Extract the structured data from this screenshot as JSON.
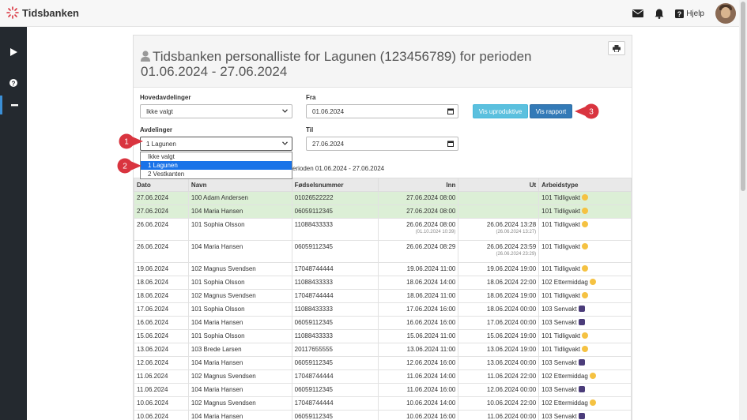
{
  "app": {
    "brand": "Tidsbanken",
    "help_label": "Hjelp"
  },
  "page": {
    "title": "Tidsbanken personalliste for Lagunen (123456789) for perioden 01.06.2024 - 27.06.2024"
  },
  "form": {
    "hovedavdelinger_label": "Hovedavdelinger",
    "hovedavdelinger_value": "Ikke valgt",
    "avdelinger_label": "Avdelinger",
    "avdelinger_value": "1 Lagunen",
    "avdelinger_options": [
      "Ikke valgt",
      "1 Lagunen",
      "2 Vestkanten"
    ],
    "fra_label": "Fra",
    "fra_value": "01.06.2024",
    "til_label": "Til",
    "til_value": "27.06.2024",
    "vis_uproduktive": "Vis uproduktive",
    "vis_rapport": "Vis rapport",
    "period_text": "erioden 01.06.2024 - 27.06.2024"
  },
  "callouts": [
    "1",
    "2",
    "3"
  ],
  "table": {
    "headers": [
      "Dato",
      "Navn",
      "Fødselsnummer",
      "Inn",
      "Ut",
      "Arbeidstype"
    ],
    "rows": [
      {
        "dato": "27.06.2024",
        "navn": "100 Adam Andersen",
        "fnr": "01026522222",
        "inn": "27.06.2024 08:00",
        "inn_sub": "",
        "ut": "",
        "ut_sub": "",
        "type": "101 Tidligvakt",
        "icon": "sun",
        "green": true
      },
      {
        "dato": "27.06.2024",
        "navn": "104 Maria Hansen",
        "fnr": "06059112345",
        "inn": "27.06.2024 08:00",
        "inn_sub": "",
        "ut": "",
        "ut_sub": "",
        "type": "101 Tidligvakt",
        "icon": "sun",
        "green": true
      },
      {
        "dato": "26.06.2024",
        "navn": "101 Sophia Olsson",
        "fnr": "11088433333",
        "inn": "26.06.2024 08:00",
        "inn_sub": "(01.10.2024 10:39)",
        "ut": "26.06.2024 13:28",
        "ut_sub": "(26.06.2024 13:27)",
        "type": "101 Tidligvakt",
        "icon": "sun",
        "green": false
      },
      {
        "dato": "26.06.2024",
        "navn": "104 Maria Hansen",
        "fnr": "06059112345",
        "inn": "26.06.2024 08:29",
        "inn_sub": "",
        "ut": "26.06.2024 23:59",
        "ut_sub": "(26.06.2024 23:29)",
        "type": "101 Tidligvakt",
        "icon": "sun",
        "green": false
      },
      {
        "dato": "19.06.2024",
        "navn": "102 Magnus Svendsen",
        "fnr": "17048744444",
        "inn": "19.06.2024 11:00",
        "inn_sub": "",
        "ut": "19.06.2024 19:00",
        "ut_sub": "",
        "type": "101 Tidligvakt",
        "icon": "sun",
        "green": false
      },
      {
        "dato": "18.06.2024",
        "navn": "101 Sophia Olsson",
        "fnr": "11088433333",
        "inn": "18.06.2024 14:00",
        "inn_sub": "",
        "ut": "18.06.2024 22:00",
        "ut_sub": "",
        "type": "102 Ettermiddag",
        "icon": "sun",
        "green": false
      },
      {
        "dato": "18.06.2024",
        "navn": "102 Magnus Svendsen",
        "fnr": "17048744444",
        "inn": "18.06.2024 11:00",
        "inn_sub": "",
        "ut": "18.06.2024 19:00",
        "ut_sub": "",
        "type": "101 Tidligvakt",
        "icon": "sun",
        "green": false
      },
      {
        "dato": "17.06.2024",
        "navn": "101 Sophia Olsson",
        "fnr": "11088433333",
        "inn": "17.06.2024 16:00",
        "inn_sub": "",
        "ut": "18.06.2024 00:00",
        "ut_sub": "",
        "type": "103 Senvakt",
        "icon": "moon",
        "green": false
      },
      {
        "dato": "16.06.2024",
        "navn": "104 Maria Hansen",
        "fnr": "06059112345",
        "inn": "16.06.2024 16:00",
        "inn_sub": "",
        "ut": "17.06.2024 00:00",
        "ut_sub": "",
        "type": "103 Senvakt",
        "icon": "moon",
        "green": false
      },
      {
        "dato": "15.06.2024",
        "navn": "101 Sophia Olsson",
        "fnr": "11088433333",
        "inn": "15.06.2024 11:00",
        "inn_sub": "",
        "ut": "15.06.2024 19:00",
        "ut_sub": "",
        "type": "101 Tidligvakt",
        "icon": "sun",
        "green": false
      },
      {
        "dato": "13.06.2024",
        "navn": "103 Brede Larsen",
        "fnr": "20117655555",
        "inn": "13.06.2024 11:00",
        "inn_sub": "",
        "ut": "13.06.2024 19:00",
        "ut_sub": "",
        "type": "101 Tidligvakt",
        "icon": "sun",
        "green": false
      },
      {
        "dato": "12.06.2024",
        "navn": "104 Maria Hansen",
        "fnr": "06059112345",
        "inn": "12.06.2024 16:00",
        "inn_sub": "",
        "ut": "13.06.2024 00:00",
        "ut_sub": "",
        "type": "103 Senvakt",
        "icon": "moon",
        "green": false
      },
      {
        "dato": "11.06.2024",
        "navn": "102 Magnus Svendsen",
        "fnr": "17048744444",
        "inn": "11.06.2024 14:00",
        "inn_sub": "",
        "ut": "11.06.2024 22:00",
        "ut_sub": "",
        "type": "102 Ettermiddag",
        "icon": "sun",
        "green": false
      },
      {
        "dato": "11.06.2024",
        "navn": "104 Maria Hansen",
        "fnr": "06059112345",
        "inn": "11.06.2024 16:00",
        "inn_sub": "",
        "ut": "12.06.2024 00:00",
        "ut_sub": "",
        "type": "103 Senvakt",
        "icon": "moon",
        "green": false
      },
      {
        "dato": "10.06.2024",
        "navn": "102 Magnus Svendsen",
        "fnr": "17048744444",
        "inn": "10.06.2024 14:00",
        "inn_sub": "",
        "ut": "10.06.2024 22:00",
        "ut_sub": "",
        "type": "102 Ettermiddag",
        "icon": "sun",
        "green": false
      },
      {
        "dato": "10.06.2024",
        "navn": "104 Maria Hansen",
        "fnr": "06059112345",
        "inn": "10.06.2024 16:00",
        "inn_sub": "",
        "ut": "11.06.2024 00:00",
        "ut_sub": "",
        "type": "103 Senvakt",
        "icon": "moon",
        "green": false
      }
    ]
  },
  "colors": {
    "sidebar": "#24292f",
    "accent_info": "#5bc0de",
    "accent_primary": "#337ab7",
    "callout_red": "#d9343f",
    "row_green": "#dcefd6"
  }
}
